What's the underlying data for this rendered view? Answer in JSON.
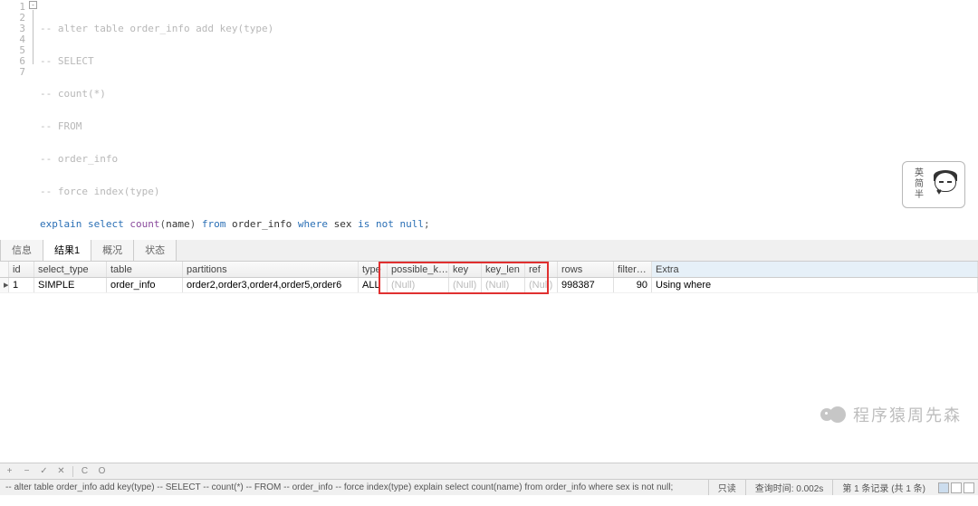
{
  "editor": {
    "lines": [
      {
        "n": "1",
        "type": "comment",
        "text": "-- alter table order_info add key(type)"
      },
      {
        "n": "2",
        "type": "comment",
        "text": "-- SELECT"
      },
      {
        "n": "3",
        "type": "comment",
        "text": "-- count(*)"
      },
      {
        "n": "4",
        "type": "comment",
        "text": "-- FROM"
      },
      {
        "n": "5",
        "type": "comment",
        "text": "-- order_info"
      },
      {
        "n": "6",
        "type": "comment",
        "text": "-- force index(type)"
      },
      {
        "n": "7",
        "type": "sql"
      }
    ],
    "sql": {
      "kw1": "explain",
      "kw2": "select",
      "fn": "count",
      "arg": "name",
      "kw3": "from",
      "tbl": "order_info",
      "kw4": "where",
      "col": "sex",
      "kw5": "is",
      "kw6": "not",
      "kw7": "null",
      "term": ";"
    },
    "fold_glyph": "-"
  },
  "sticker": {
    "label": "英\n简\n半"
  },
  "tabs": [
    {
      "label": "信息",
      "active": false
    },
    {
      "label": "结果1",
      "active": true
    },
    {
      "label": "概况",
      "active": false
    },
    {
      "label": "状态",
      "active": false
    }
  ],
  "grid": {
    "headers": {
      "id": "id",
      "select_type": "select_type",
      "table": "table",
      "partitions": "partitions",
      "type": "type",
      "possible_keys": "possible_keys",
      "key": "key",
      "key_len": "key_len",
      "ref": "ref",
      "rows": "rows",
      "filtered": "filtered",
      "extra": "Extra"
    },
    "row": {
      "marker": "▸",
      "id": "1",
      "select_type": "SIMPLE",
      "table": "order_info",
      "partitions": "order2,order3,order4,order5,order6",
      "type": "ALL",
      "possible_keys": "(Null)",
      "key": "(Null)",
      "key_len": "(Null)",
      "ref": "(Null)",
      "rows": "998387",
      "filtered": "90",
      "extra": "Using where"
    }
  },
  "toolbar": {
    "plus": "+",
    "minus": "−",
    "check": "✓",
    "cancel": "✕",
    "refresh1": "C",
    "refresh2": "O"
  },
  "status": {
    "sql_echo": "-- alter table order_info add key(type) -- SELECT -- count(*) -- FROM -- order_info -- force index(type) explain select count(name) from order_info where sex is not null;",
    "readonly": "只读",
    "query_time": "查询时间: 0.002s",
    "record_info": "第 1 条记录 (共 1 条)"
  },
  "watermark": "程序猿周先森"
}
